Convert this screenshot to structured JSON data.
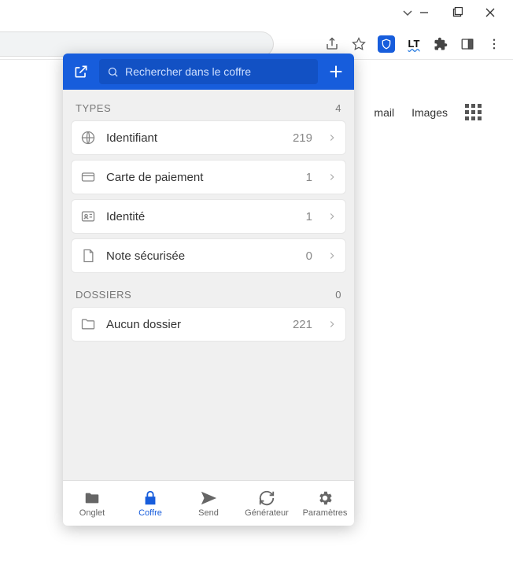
{
  "background": {
    "gmail_partial": "mail",
    "images": "Images"
  },
  "popup": {
    "search_placeholder": "Rechercher dans le coffre",
    "sections": {
      "types": {
        "title": "TYPES",
        "count": "4"
      },
      "folders": {
        "title": "DOSSIERS",
        "count": "0"
      }
    },
    "types_rows": [
      {
        "label": "Identifiant",
        "count": "219",
        "icon": "globe-icon"
      },
      {
        "label": "Carte de paiement",
        "count": "1",
        "icon": "card-icon"
      },
      {
        "label": "Identité",
        "count": "1",
        "icon": "id-icon"
      },
      {
        "label": "Note sécurisée",
        "count": "0",
        "icon": "note-icon"
      }
    ],
    "folders_rows": [
      {
        "label": "Aucun dossier",
        "count": "221",
        "icon": "folder-icon"
      }
    ],
    "footer": [
      {
        "label": "Onglet",
        "icon": "folder-tab-icon",
        "active": false
      },
      {
        "label": "Coffre",
        "icon": "lock-icon",
        "active": true
      },
      {
        "label": "Send",
        "icon": "send-icon",
        "active": false
      },
      {
        "label": "Générateur",
        "icon": "refresh-icon",
        "active": false
      },
      {
        "label": "Paramètres",
        "icon": "gear-icon",
        "active": false
      }
    ]
  }
}
